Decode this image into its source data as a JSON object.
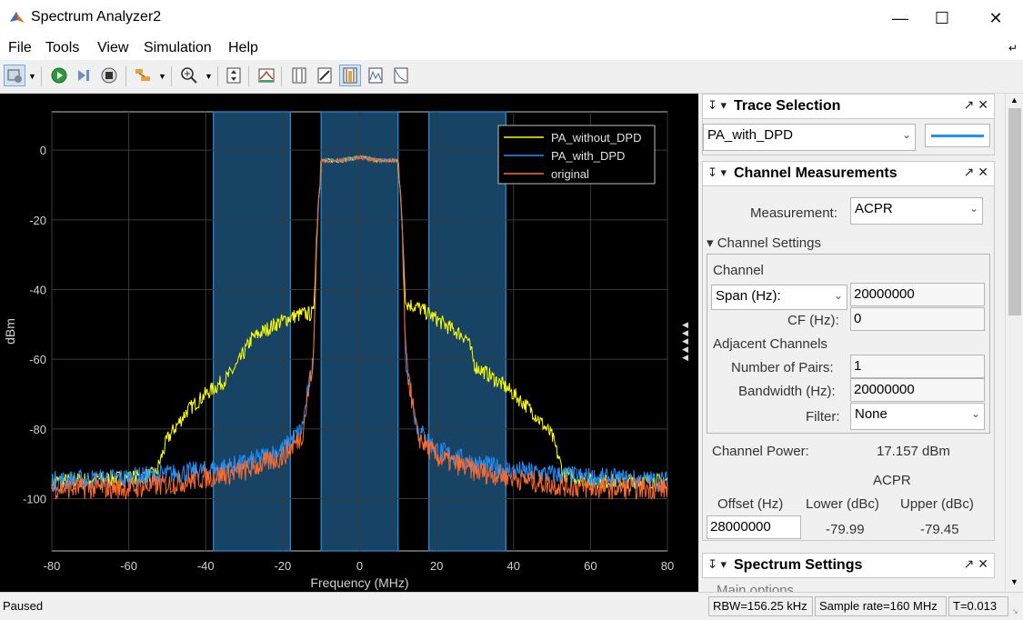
{
  "window": {
    "title": "Spectrum Analyzer2"
  },
  "menu": [
    "File",
    "Tools",
    "View",
    "Simulation",
    "Help"
  ],
  "plot": {
    "xlabel": "Frequency (MHz)",
    "ylabel": "dBm",
    "xticks": [
      "-80",
      "-60",
      "-40",
      "-20",
      "0",
      "20",
      "40",
      "60",
      "80"
    ],
    "yticks": [
      "0",
      "-20",
      "-40",
      "-60",
      "-80",
      "-100"
    ],
    "legend": [
      "PA_without_DPD",
      "PA_with_DPD",
      "original"
    ],
    "colors": {
      "without_dpd": "#ffff00",
      "with_dpd": "#1e90ff",
      "original": "#ff6a2a",
      "band": "#1f5a86"
    }
  },
  "chart_data": {
    "type": "line",
    "xlabel": "Frequency (MHz)",
    "ylabel": "dBm",
    "xlim": [
      -80,
      80
    ],
    "ylim": [
      -115,
      11
    ],
    "grid": true,
    "legend_position": "top-right",
    "shaded_bands": [
      [
        -38,
        -18
      ],
      [
        -10,
        10
      ],
      [
        18,
        38
      ]
    ],
    "series": [
      {
        "name": "PA_without_DPD",
        "x": [
          -80,
          -60,
          -53,
          -50,
          -45,
          -40,
          -35,
          -32,
          -28,
          -22,
          -18,
          -15,
          -12,
          -11,
          -10,
          -5,
          0,
          5,
          10,
          11,
          12,
          15,
          18,
          22,
          28,
          30,
          33,
          38,
          45,
          50,
          53,
          60,
          80
        ],
        "y": [
          -95,
          -94,
          -93,
          -83,
          -75,
          -70,
          -66,
          -62,
          -54,
          -50,
          -48,
          -47,
          -47,
          -20,
          -3,
          -3,
          -2,
          -3,
          -3,
          -20,
          -44,
          -45,
          -47,
          -50,
          -54,
          -62,
          -64,
          -68,
          -75,
          -82,
          -93,
          -95,
          -95
        ]
      },
      {
        "name": "PA_with_DPD",
        "x": [
          -80,
          -60,
          -50,
          -40,
          -30,
          -25,
          -20,
          -15,
          -12,
          -11,
          -10,
          -5,
          0,
          5,
          10,
          11,
          12,
          15,
          20,
          25,
          30,
          40,
          50,
          60,
          80
        ],
        "y": [
          -95,
          -94,
          -93,
          -92,
          -90,
          -88,
          -86,
          -80,
          -60,
          -20,
          -3,
          -3,
          -2,
          -3,
          -3,
          -20,
          -60,
          -80,
          -86,
          -88,
          -90,
          -92,
          -93,
          -94,
          -95
        ]
      },
      {
        "name": "original",
        "x": [
          -80,
          -60,
          -50,
          -40,
          -30,
          -25,
          -20,
          -15,
          -12,
          -11,
          -10,
          -5,
          0,
          5,
          10,
          11,
          12,
          15,
          20,
          25,
          30,
          40,
          50,
          60,
          80
        ],
        "y": [
          -97,
          -97,
          -96,
          -94,
          -92,
          -90,
          -88,
          -82,
          -60,
          -20,
          -3,
          -3,
          -2,
          -3,
          -3,
          -20,
          -60,
          -82,
          -88,
          -90,
          -92,
          -94,
          -96,
          -97,
          -97
        ]
      }
    ]
  },
  "panel": {
    "trace_selection": {
      "title": "Trace Selection",
      "selected": "PA_with_DPD"
    },
    "channel_measurements": {
      "title": "Channel Measurements",
      "measurement_label": "Measurement:",
      "measurement_value": "ACPR",
      "channel_settings_label": "▾ Channel Settings",
      "channel_label": "Channel",
      "span_label": "Span (Hz):",
      "span_value": "20000000",
      "cf_label": "CF (Hz):",
      "cf_value": "0",
      "adjacent_label": "Adjacent Channels",
      "pairs_label": "Number of Pairs:",
      "pairs_value": "1",
      "bandwidth_label": "Bandwidth (Hz):",
      "bandwidth_value": "20000000",
      "filter_label": "Filter:",
      "filter_value": "None",
      "channel_power_label": "Channel Power:",
      "channel_power_value": "17.157 dBm",
      "acpr_heading": "ACPR",
      "offset_header": "Offset (Hz)",
      "lower_header": "Lower (dBc)",
      "upper_header": "Upper (dBc)",
      "offset_value": "28000000",
      "lower_value": "-79.99",
      "upper_value": "-79.45"
    },
    "spectrum_settings": {
      "title": "Spectrum Settings",
      "subtitle": "Main options"
    }
  },
  "status": {
    "state": "Paused",
    "rbw": "RBW=156.25 kHz",
    "sample_rate": "Sample rate=160 MHz",
    "time": "T=0.013"
  }
}
